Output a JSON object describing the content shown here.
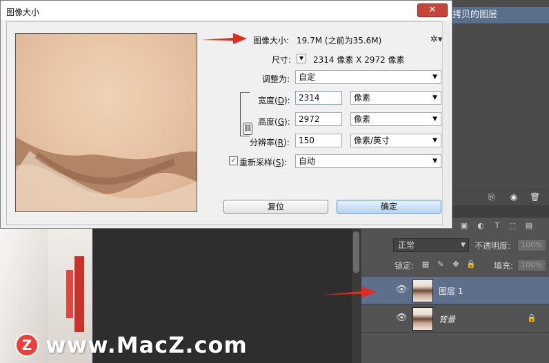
{
  "dialog": {
    "title": "图像大小",
    "close_label": "✕",
    "image_size_label": "图像大小:",
    "image_size_value": "19.7M (之前为35.6M)",
    "dimensions_label": "尺寸:",
    "dimensions_value": "2314 像素  X  2972 像素",
    "fit_to_label": "调整为:",
    "fit_to_value": "自定",
    "width_label": "宽度",
    "width_key": "D",
    "width_value": "2314",
    "width_unit": "像素",
    "height_label": "高度",
    "height_key": "G",
    "height_value": "2972",
    "height_unit": "像素",
    "resolution_label": "分辨率",
    "resolution_key": "R",
    "resolution_value": "150",
    "resolution_unit": "像素/英寸",
    "resample_label": "重新采样",
    "resample_key": "S",
    "resample_checked": true,
    "resample_value": "自动",
    "reset_label": "复位",
    "ok_label": "确定",
    "gear_icon": "gear-icon"
  },
  "history": {
    "item_label": "拷贝的图层"
  },
  "layers": {
    "blend_mode": "正常",
    "opacity_label": "不透明度:",
    "opacity_value": "100%",
    "lock_label": "锁定:",
    "fill_label": "填充:",
    "fill_value": "100%",
    "items": [
      {
        "name": "图层 1",
        "selected": true
      },
      {
        "name": "背景",
        "locked": true
      }
    ]
  },
  "watermark": {
    "badge": "Z",
    "text": "www.MacZ.com"
  },
  "colors": {
    "accent_selected": "#5d6f8a",
    "arrow_red": "#e02a22",
    "close_red": "#c6453a"
  }
}
